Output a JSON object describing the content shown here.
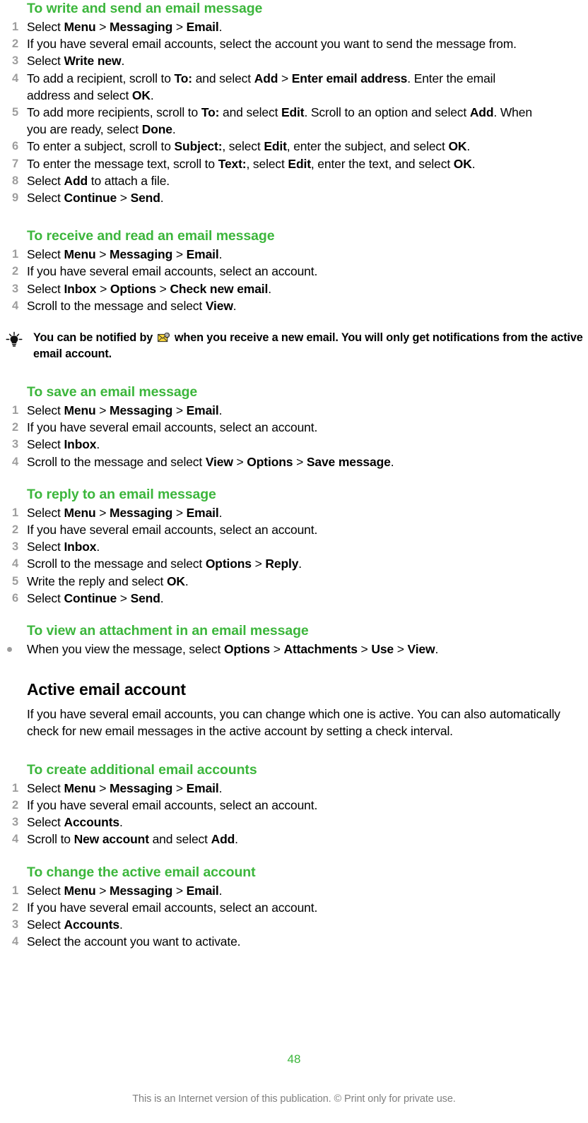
{
  "page": {
    "number": "48",
    "footer_note": "This is an Internet version of this publication. © Print only for private use.",
    "accent_color": "#3cb63c",
    "number_color": "#9d9d9d",
    "footer_color": "#808080"
  },
  "sections": {
    "write_send": {
      "heading": "To write and send an email message",
      "steps": [
        {
          "n": "1",
          "parts": [
            {
              "t": "Select ",
              "b": false
            },
            {
              "t": "Menu",
              "b": true
            },
            {
              "t": " > ",
              "b": false
            },
            {
              "t": "Messaging",
              "b": true
            },
            {
              "t": " > ",
              "b": false
            },
            {
              "t": "Email",
              "b": true
            },
            {
              "t": ".",
              "b": false
            }
          ]
        },
        {
          "n": "2",
          "parts": [
            {
              "t": "If you have several email accounts, select the account you want to send the message from.",
              "b": false
            }
          ]
        },
        {
          "n": "3",
          "parts": [
            {
              "t": "Select ",
              "b": false
            },
            {
              "t": "Write new",
              "b": true
            },
            {
              "t": ".",
              "b": false
            }
          ]
        },
        {
          "n": "4",
          "parts": [
            {
              "t": "To add a recipient, scroll to ",
              "b": false
            },
            {
              "t": "To:",
              "b": true
            },
            {
              "t": " and select ",
              "b": false
            },
            {
              "t": "Add",
              "b": true
            },
            {
              "t": " > ",
              "b": false
            },
            {
              "t": "Enter email address",
              "b": true
            },
            {
              "t": ". Enter the email address and select ",
              "b": false
            },
            {
              "t": "OK",
              "b": true
            },
            {
              "t": ".",
              "b": false
            }
          ]
        },
        {
          "n": "5",
          "parts": [
            {
              "t": "To add more recipients, scroll to ",
              "b": false
            },
            {
              "t": "To:",
              "b": true
            },
            {
              "t": " and select ",
              "b": false
            },
            {
              "t": "Edit",
              "b": true
            },
            {
              "t": ". Scroll to an option and select ",
              "b": false
            },
            {
              "t": "Add",
              "b": true
            },
            {
              "t": ". When you are ready, select ",
              "b": false
            },
            {
              "t": "Done",
              "b": true
            },
            {
              "t": ".",
              "b": false
            }
          ]
        },
        {
          "n": "6",
          "parts": [
            {
              "t": "To enter a subject, scroll to ",
              "b": false
            },
            {
              "t": "Subject:",
              "b": true
            },
            {
              "t": ", select ",
              "b": false
            },
            {
              "t": "Edit",
              "b": true
            },
            {
              "t": ", enter the subject, and select ",
              "b": false
            },
            {
              "t": "OK",
              "b": true
            },
            {
              "t": ".",
              "b": false
            }
          ]
        },
        {
          "n": "7",
          "parts": [
            {
              "t": "To enter the message text, scroll to ",
              "b": false
            },
            {
              "t": "Text:",
              "b": true
            },
            {
              "t": ", select ",
              "b": false
            },
            {
              "t": "Edit",
              "b": true
            },
            {
              "t": ", enter the text, and select ",
              "b": false
            },
            {
              "t": "OK",
              "b": true
            },
            {
              "t": ".",
              "b": false
            }
          ]
        },
        {
          "n": "8",
          "parts": [
            {
              "t": "Select ",
              "b": false
            },
            {
              "t": "Add",
              "b": true
            },
            {
              "t": " to attach a file.",
              "b": false
            }
          ]
        },
        {
          "n": "9",
          "parts": [
            {
              "t": "Select ",
              "b": false
            },
            {
              "t": "Continue",
              "b": true
            },
            {
              "t": " > ",
              "b": false
            },
            {
              "t": "Send",
              "b": true
            },
            {
              "t": ".",
              "b": false
            }
          ]
        }
      ]
    },
    "receive_read": {
      "heading": "To receive and read an email message",
      "steps": [
        {
          "n": "1",
          "parts": [
            {
              "t": "Select ",
              "b": false
            },
            {
              "t": "Menu",
              "b": true
            },
            {
              "t": " > ",
              "b": false
            },
            {
              "t": "Messaging",
              "b": true
            },
            {
              "t": " > ",
              "b": false
            },
            {
              "t": "Email",
              "b": true
            },
            {
              "t": ".",
              "b": false
            }
          ]
        },
        {
          "n": "2",
          "parts": [
            {
              "t": "If you have several email accounts, select an account.",
              "b": false
            }
          ]
        },
        {
          "n": "3",
          "parts": [
            {
              "t": "Select ",
              "b": false
            },
            {
              "t": "Inbox",
              "b": true
            },
            {
              "t": " > ",
              "b": false
            },
            {
              "t": "Options",
              "b": true
            },
            {
              "t": " > ",
              "b": false
            },
            {
              "t": "Check new email",
              "b": true
            },
            {
              "t": ".",
              "b": false
            }
          ]
        },
        {
          "n": "4",
          "parts": [
            {
              "t": "Scroll to the message and select ",
              "b": false
            },
            {
              "t": "View",
              "b": true
            },
            {
              "t": ".",
              "b": false
            }
          ]
        }
      ]
    },
    "tip": {
      "icon": "lightbulb-tip-icon",
      "inline_icon": "new-email-envelope-icon",
      "text_before": "You can be notified by",
      "text_after": "when you receive a new email. You will only get notifications from the active email account."
    },
    "save": {
      "heading": "To save an email message",
      "steps": [
        {
          "n": "1",
          "parts": [
            {
              "t": "Select ",
              "b": false
            },
            {
              "t": "Menu",
              "b": true
            },
            {
              "t": " > ",
              "b": false
            },
            {
              "t": "Messaging",
              "b": true
            },
            {
              "t": " > ",
              "b": false
            },
            {
              "t": "Email",
              "b": true
            },
            {
              "t": ".",
              "b": false
            }
          ]
        },
        {
          "n": "2",
          "parts": [
            {
              "t": "If you have several email accounts, select an account.",
              "b": false
            }
          ]
        },
        {
          "n": "3",
          "parts": [
            {
              "t": "Select ",
              "b": false
            },
            {
              "t": "Inbox",
              "b": true
            },
            {
              "t": ".",
              "b": false
            }
          ]
        },
        {
          "n": "4",
          "parts": [
            {
              "t": "Scroll to the message and select ",
              "b": false
            },
            {
              "t": "View",
              "b": true
            },
            {
              "t": " > ",
              "b": false
            },
            {
              "t": "Options",
              "b": true
            },
            {
              "t": " > ",
              "b": false
            },
            {
              "t": "Save message",
              "b": true
            },
            {
              "t": ".",
              "b": false
            }
          ]
        }
      ]
    },
    "reply": {
      "heading": "To reply to an email message",
      "steps": [
        {
          "n": "1",
          "parts": [
            {
              "t": "Select ",
              "b": false
            },
            {
              "t": "Menu",
              "b": true
            },
            {
              "t": " > ",
              "b": false
            },
            {
              "t": "Messaging",
              "b": true
            },
            {
              "t": " > ",
              "b": false
            },
            {
              "t": "Email",
              "b": true
            },
            {
              "t": ".",
              "b": false
            }
          ]
        },
        {
          "n": "2",
          "parts": [
            {
              "t": "If you have several email accounts, select an account.",
              "b": false
            }
          ]
        },
        {
          "n": "3",
          "parts": [
            {
              "t": "Select ",
              "b": false
            },
            {
              "t": "Inbox",
              "b": true
            },
            {
              "t": ".",
              "b": false
            }
          ]
        },
        {
          "n": "4",
          "parts": [
            {
              "t": "Scroll to the message and select ",
              "b": false
            },
            {
              "t": "Options",
              "b": true
            },
            {
              "t": " > ",
              "b": false
            },
            {
              "t": "Reply",
              "b": true
            },
            {
              "t": ".",
              "b": false
            }
          ]
        },
        {
          "n": "5",
          "parts": [
            {
              "t": "Write the reply and select ",
              "b": false
            },
            {
              "t": "OK",
              "b": true
            },
            {
              "t": ".",
              "b": false
            }
          ]
        },
        {
          "n": "6",
          "parts": [
            {
              "t": "Select ",
              "b": false
            },
            {
              "t": "Continue",
              "b": true
            },
            {
              "t": " > ",
              "b": false
            },
            {
              "t": "Send",
              "b": true
            },
            {
              "t": ".",
              "b": false
            }
          ]
        }
      ]
    },
    "attachment": {
      "heading": "To view an attachment in an email message",
      "steps": [
        {
          "n": "•",
          "parts": [
            {
              "t": "When you view the message, select ",
              "b": false
            },
            {
              "t": "Options",
              "b": true
            },
            {
              "t": " > ",
              "b": false
            },
            {
              "t": "Attachments",
              "b": true
            },
            {
              "t": " > ",
              "b": false
            },
            {
              "t": "Use",
              "b": true
            },
            {
              "t": " > ",
              "b": false
            },
            {
              "t": "View",
              "b": true
            },
            {
              "t": ".",
              "b": false
            }
          ]
        }
      ]
    },
    "active_account": {
      "heading": "Active email account",
      "body": "If you have several email accounts, you can change which one is active. You can also automatically check for new email messages in the active account by setting a check interval."
    },
    "create_accounts": {
      "heading": "To create additional email accounts",
      "steps": [
        {
          "n": "1",
          "parts": [
            {
              "t": "Select ",
              "b": false
            },
            {
              "t": "Menu",
              "b": true
            },
            {
              "t": " > ",
              "b": false
            },
            {
              "t": "Messaging",
              "b": true
            },
            {
              "t": " > ",
              "b": false
            },
            {
              "t": "Email",
              "b": true
            },
            {
              "t": ".",
              "b": false
            }
          ]
        },
        {
          "n": "2",
          "parts": [
            {
              "t": "If you have several email accounts, select an account.",
              "b": false
            }
          ]
        },
        {
          "n": "3",
          "parts": [
            {
              "t": "Select ",
              "b": false
            },
            {
              "t": "Accounts",
              "b": true
            },
            {
              "t": ".",
              "b": false
            }
          ]
        },
        {
          "n": "4",
          "parts": [
            {
              "t": "Scroll to ",
              "b": false
            },
            {
              "t": "New account",
              "b": true
            },
            {
              "t": " and select ",
              "b": false
            },
            {
              "t": "Add",
              "b": true
            },
            {
              "t": ".",
              "b": false
            }
          ]
        }
      ]
    },
    "change_active": {
      "heading": "To change the active email account",
      "steps": [
        {
          "n": "1",
          "parts": [
            {
              "t": "Select ",
              "b": false
            },
            {
              "t": "Menu",
              "b": true
            },
            {
              "t": " > ",
              "b": false
            },
            {
              "t": "Messaging",
              "b": true
            },
            {
              "t": " > ",
              "b": false
            },
            {
              "t": "Email",
              "b": true
            },
            {
              "t": ".",
              "b": false
            }
          ]
        },
        {
          "n": "2",
          "parts": [
            {
              "t": "If you have several email accounts, select an account.",
              "b": false
            }
          ]
        },
        {
          "n": "3",
          "parts": [
            {
              "t": "Select ",
              "b": false
            },
            {
              "t": "Accounts",
              "b": true
            },
            {
              "t": ".",
              "b": false
            }
          ]
        },
        {
          "n": "4",
          "parts": [
            {
              "t": "Select the account you want to activate.",
              "b": false
            }
          ]
        }
      ]
    }
  }
}
